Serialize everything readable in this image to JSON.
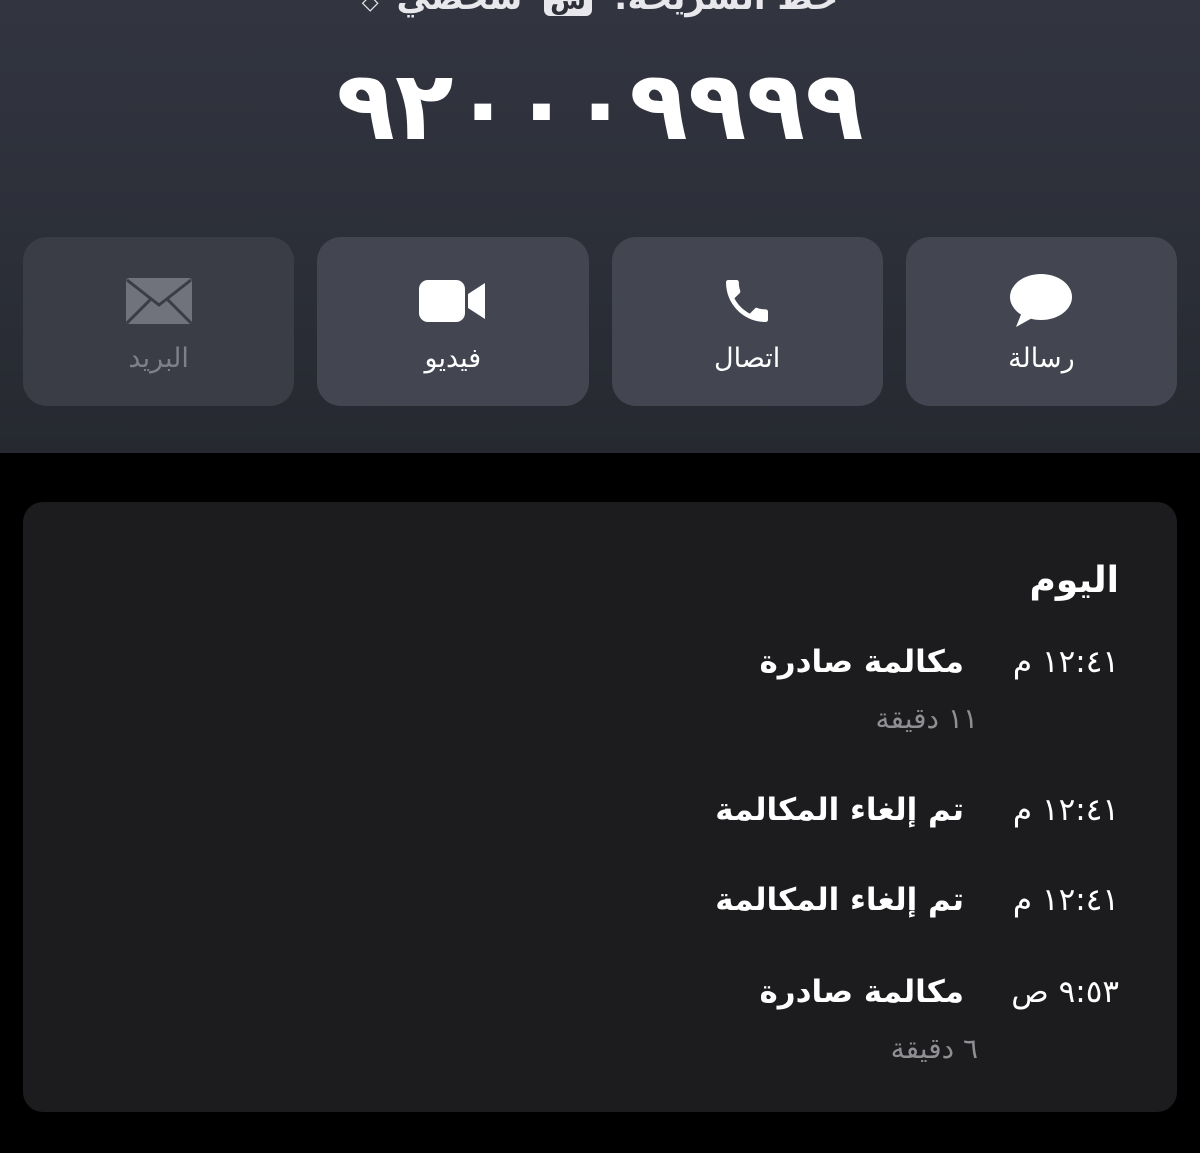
{
  "header": {
    "sim_label": "خط الشريحة:",
    "sim_badge": "ش",
    "sim_name": "شخصي",
    "phone_number": "٩٢٠٠٠٩٩٩٩"
  },
  "actions": [
    {
      "label": "رسالة",
      "icon": "message-bubble-icon",
      "enabled": true
    },
    {
      "label": "اتصال",
      "icon": "phone-icon",
      "enabled": true
    },
    {
      "label": "فيديو",
      "icon": "video-camera-icon",
      "enabled": true
    },
    {
      "label": "البريد",
      "icon": "mail-envelope-icon",
      "enabled": false
    }
  ],
  "history": {
    "title": "اليوم",
    "calls": [
      {
        "time": "١٢:٤١ م",
        "type": "مكالمة صادرة",
        "duration": "١١ دقيقة"
      },
      {
        "time": "١٢:٤١ م",
        "type": "تم إلغاء المكالمة",
        "duration": ""
      },
      {
        "time": "١٢:٤١ م",
        "type": "تم إلغاء المكالمة",
        "duration": ""
      },
      {
        "time": "٩:٥٣ ص",
        "type": "مكالمة صادرة",
        "duration": "٦ دقيقة"
      }
    ]
  },
  "colors": {
    "header_bg": "#2c2f38",
    "button_bg": "#434651",
    "card_bg": "#1c1c1e",
    "secondary_text": "#8e8e93",
    "disabled_text": "#7d8089"
  }
}
